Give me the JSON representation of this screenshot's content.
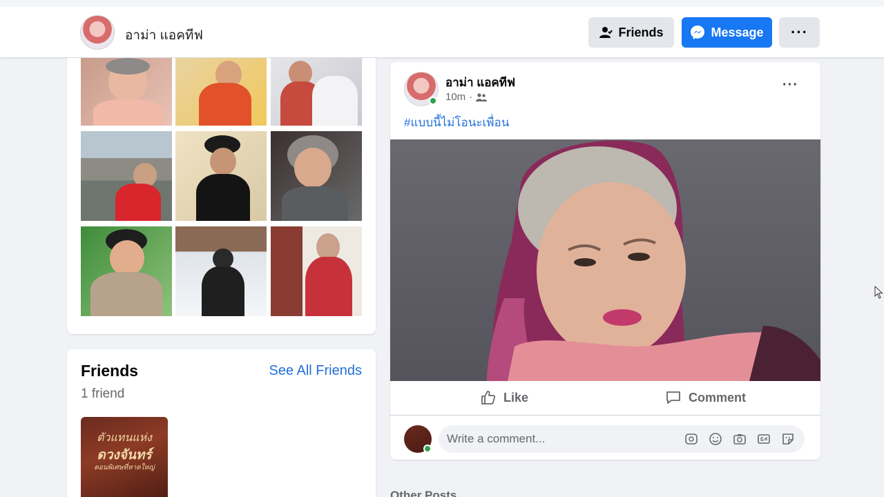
{
  "header": {
    "page_name": "อาม่า แอคทีฟ",
    "friends_button": "Friends",
    "message_button": "Message",
    "more_button": "···"
  },
  "friends_section": {
    "title": "Friends",
    "see_all": "See All Friends",
    "count": "1 friend",
    "friend_thumb_lines": [
      "ตัวแทนแห่ง",
      "ดวงจันทร์",
      "ตอนพิเศษที่หาดใหญ่"
    ]
  },
  "post": {
    "author": "อาม่า แอคทีฟ",
    "time": "10m",
    "meta_separator": "·",
    "audience_icon": "friends-audience-icon",
    "more": "···",
    "hashtag": "#แบบนี้ไม่โอนะเพื่อน",
    "like_label": "Like",
    "comment_label": "Comment",
    "comment_placeholder": "Write a comment..."
  },
  "other_posts_label": "Other Posts",
  "colors": {
    "accent": "#1877f2",
    "link": "#216fdb",
    "online": "#31a24c",
    "background": "#f0f2f5"
  }
}
